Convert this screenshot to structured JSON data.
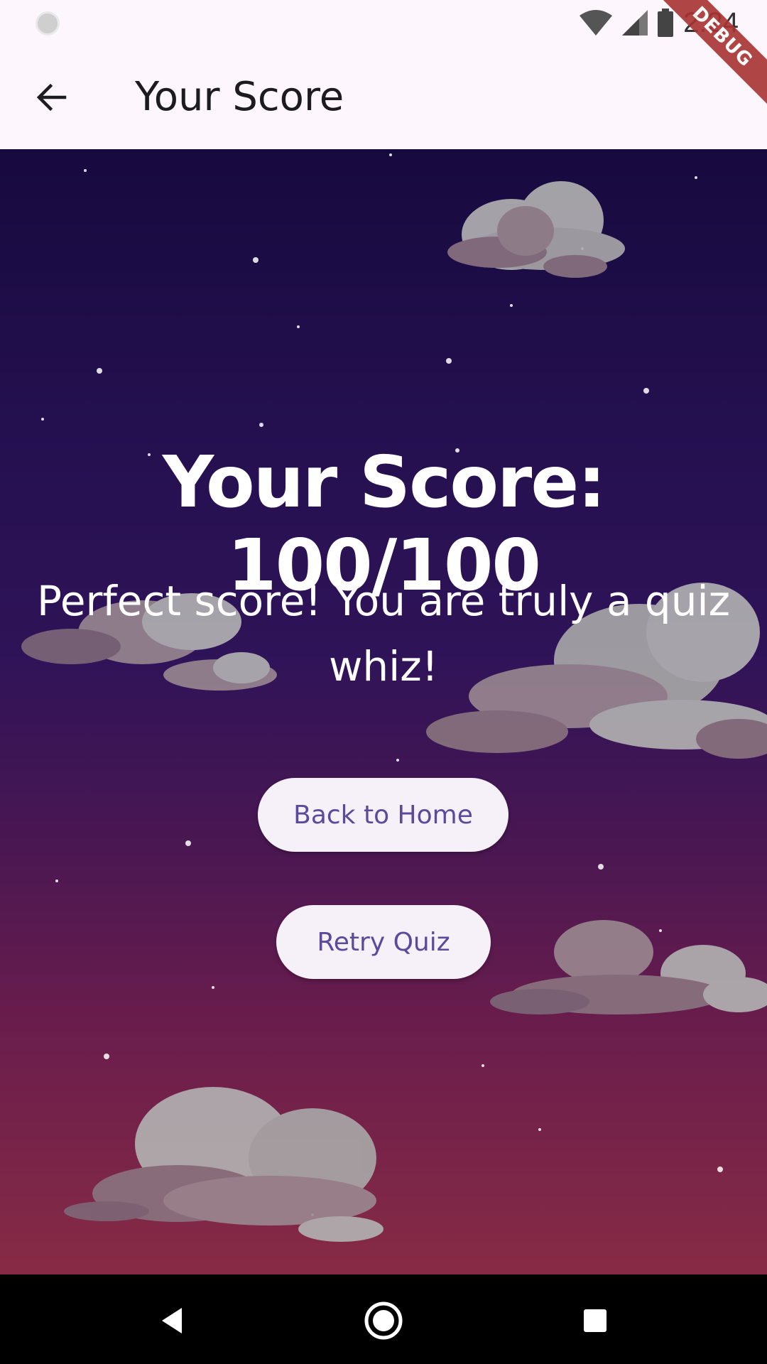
{
  "status_bar": {
    "time": "2:24"
  },
  "app_bar": {
    "title": "Your Score",
    "debug_label": "DEBUG"
  },
  "result": {
    "score_text": "Your Score: 100/100",
    "message": "Perfect score! You are truly a quiz whiz!"
  },
  "buttons": {
    "home_label": "Back to Home",
    "retry_label": "Retry Quiz"
  },
  "nav": {
    "back": "nav-back-triangle-icon",
    "home": "nav-home-circle-icon",
    "recents": "nav-recents-square-icon"
  },
  "colors": {
    "app_bar": "#fdf7fd",
    "button_bg": "#f6f0f8",
    "button_text": "#5a4a9c",
    "sky_top": "#170a3f",
    "sky_bottom": "#872b45"
  }
}
